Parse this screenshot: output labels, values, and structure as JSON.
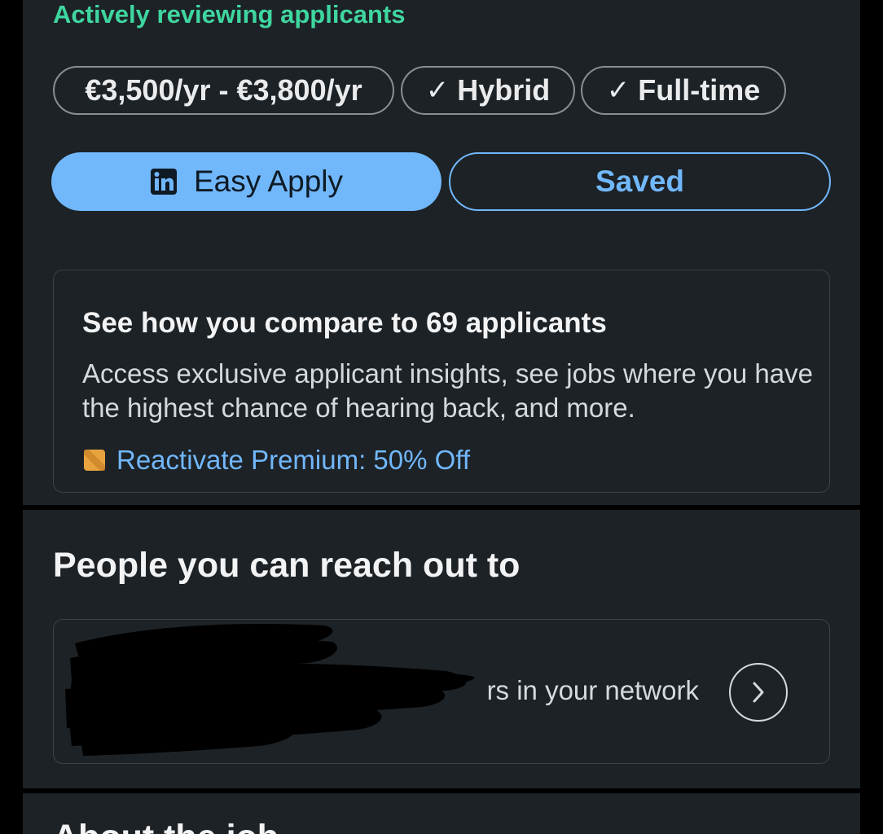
{
  "job": {
    "status": "Actively reviewing applicants",
    "chips": {
      "salary": "€3,500/yr - €3,800/yr",
      "workplace": "Hybrid",
      "employment": "Full-time"
    },
    "check_glyph": "✓",
    "actions": {
      "easy_apply_label": "Easy Apply",
      "saved_label": "Saved"
    }
  },
  "premium_card": {
    "title": "See how you compare to 69 applicants",
    "body": "Access exclusive applicant insights, see jobs where you have the highest chance of hearing back, and more.",
    "cta": "Reactivate Premium: 50% Off"
  },
  "people": {
    "section_title": "People you can reach out to",
    "network_text": "rs in your network"
  },
  "about": {
    "section_title": "About the job"
  },
  "icons": {
    "apply": "linkedin-icon",
    "premium": "premium-badge-icon",
    "next": "chevron-right-icon"
  },
  "colors": {
    "background": "#1d2226",
    "accent": "#71b7fb",
    "status_green": "#3fd6a0",
    "premium_gold": "#e7a33e"
  }
}
